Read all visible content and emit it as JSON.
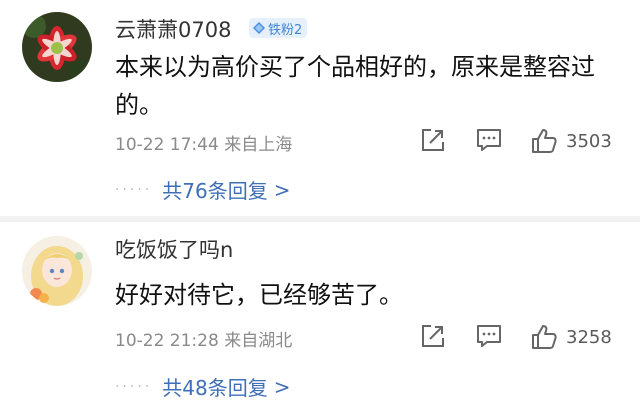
{
  "comments": [
    {
      "username": "云萧萧0708",
      "badge": "铁粉2",
      "text": "本来以为高价买了个品相好的，原来是整容过的。",
      "meta": "10-22 17:44  来自上海",
      "likes": "3503",
      "replies": "共76条回复",
      "avatar": "flower-avatar"
    },
    {
      "username": "吃饭饭了吗n",
      "text": "好好对待它，已经够苦了。",
      "meta": "10-22 21:28  来自湖北",
      "likes": "3258",
      "replies": "共48条回复",
      "avatar": "anime-girl-avatar"
    }
  ],
  "icons": {
    "share": "share-icon",
    "comment": "comment-icon",
    "like": "thumbs-up-icon",
    "badge": "diamond-icon"
  },
  "ui": {
    "more_arrow": ">",
    "reply_dots": "·····"
  },
  "colors": {
    "link": "#3f6fb6",
    "badge_bg": "#e5f0fb",
    "badge_text": "#3f86d9",
    "meta": "#8a8a8a"
  }
}
